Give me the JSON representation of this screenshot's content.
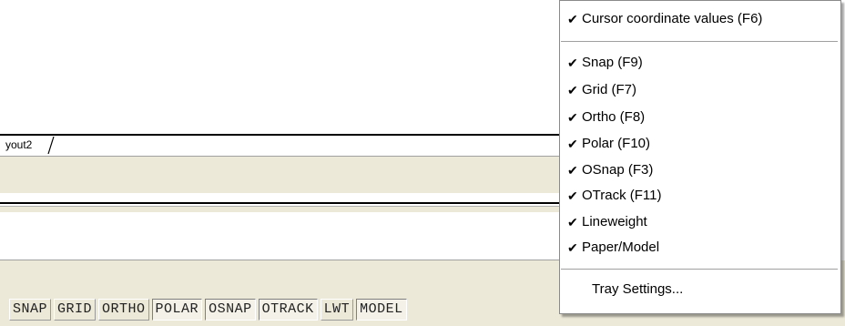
{
  "layout_tab": {
    "label": "yout2"
  },
  "status_toggles": [
    {
      "label": "SNAP",
      "pressed": false
    },
    {
      "label": "GRID",
      "pressed": false
    },
    {
      "label": "ORTHO",
      "pressed": false
    },
    {
      "label": "POLAR",
      "pressed": true
    },
    {
      "label": "OSNAP",
      "pressed": true
    },
    {
      "label": "OTRACK",
      "pressed": true
    },
    {
      "label": "LWT",
      "pressed": false
    },
    {
      "label": "MODEL",
      "pressed": true
    }
  ],
  "tray_menu": {
    "items": [
      {
        "label": "Cursor coordinate values (F6)",
        "checked": true
      },
      {
        "label": "Snap (F9)",
        "checked": true
      },
      {
        "label": "Grid (F7)",
        "checked": true
      },
      {
        "label": "Ortho (F8)",
        "checked": true
      },
      {
        "label": "Polar (F10)",
        "checked": true
      },
      {
        "label": "OSnap (F3)",
        "checked": true
      },
      {
        "label": "OTrack (F11)",
        "checked": true
      },
      {
        "label": "Lineweight",
        "checked": true
      },
      {
        "label": "Paper/Model",
        "checked": true
      },
      {
        "label": "Tray Settings...",
        "checked": false
      }
    ],
    "check_glyph": "✔"
  }
}
